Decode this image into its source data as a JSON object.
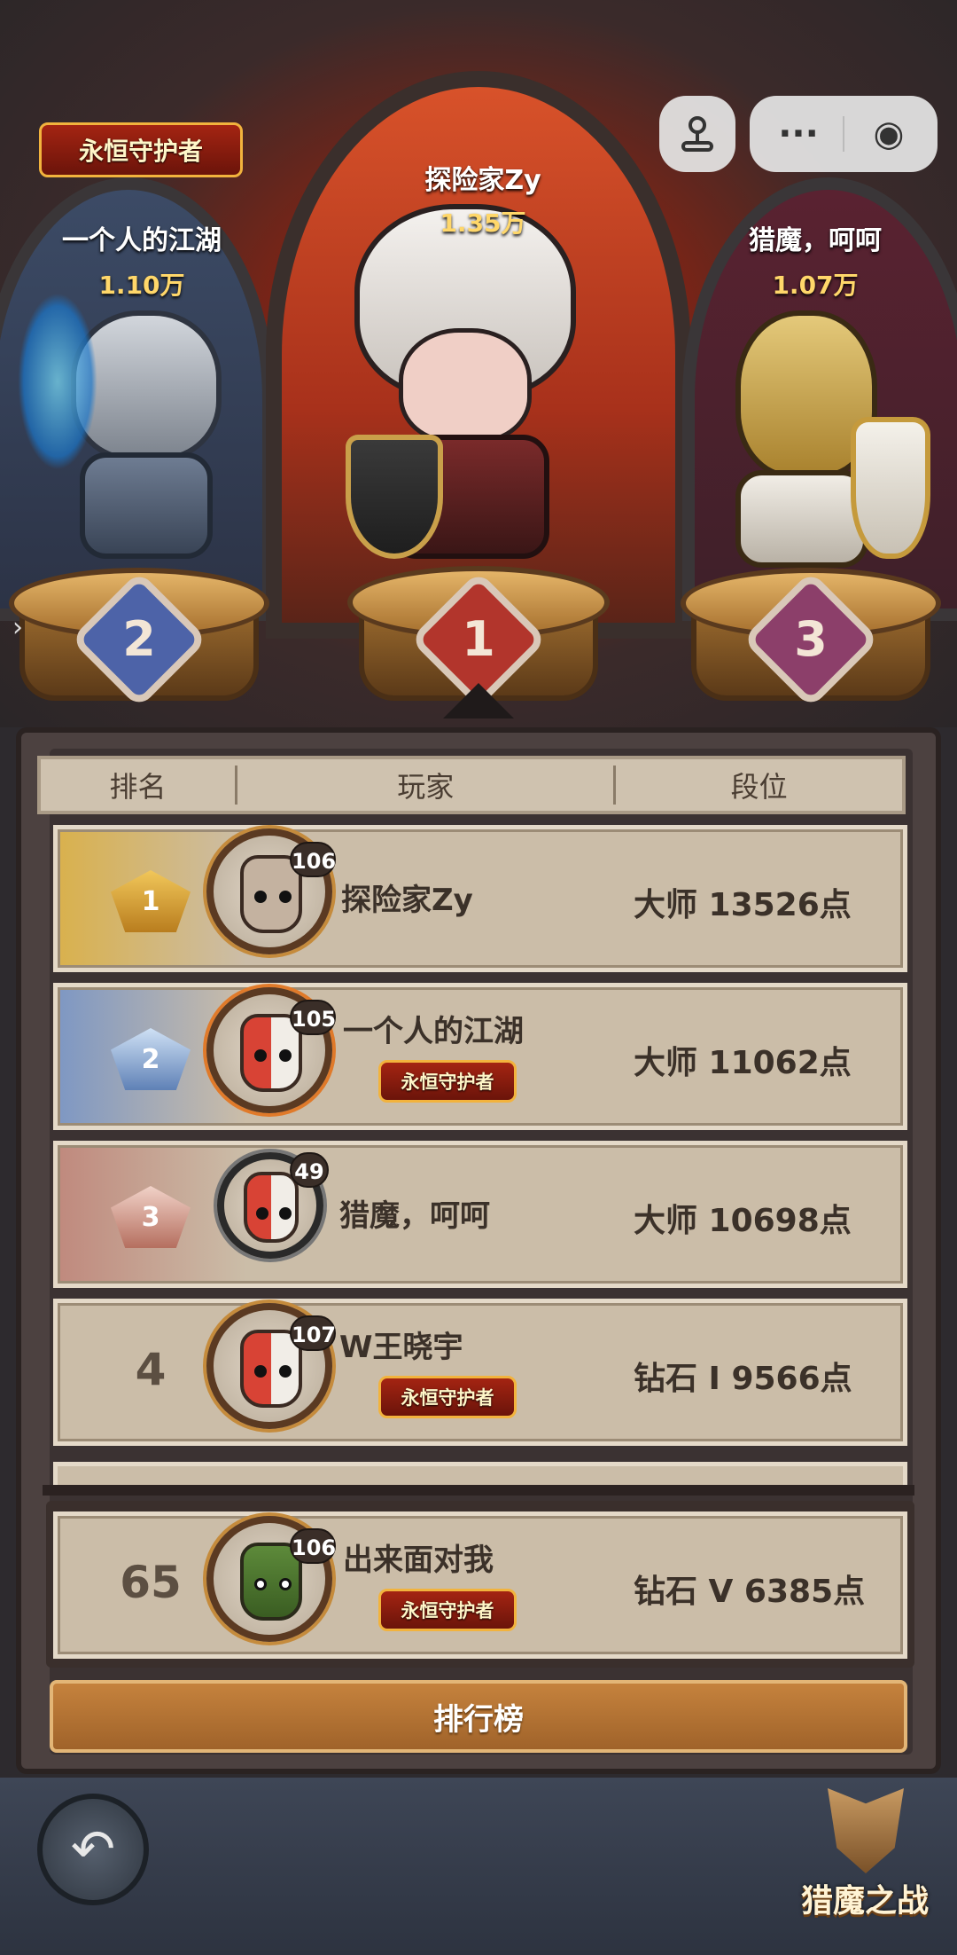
{
  "top3": [
    {
      "rank_badge": "1",
      "name": "探险家Zy",
      "score": "1.35万"
    },
    {
      "rank_badge": "2",
      "name": "一个人的江湖",
      "score": "1.10万",
      "title_badge": "永恒守护者"
    },
    {
      "rank_badge": "3",
      "name": "猎魔，呵呵",
      "score": "1.07万"
    }
  ],
  "header": {
    "rank": "排名",
    "player": "玩家",
    "tier": "段位"
  },
  "rows": [
    {
      "rank": "1",
      "level": "106",
      "name": "探险家Zy",
      "tier": "大师 13526点"
    },
    {
      "rank": "2",
      "level": "105",
      "name": "一个人的江湖",
      "title_badge": "永恒守护者",
      "tier": "大师 11062点"
    },
    {
      "rank": "3",
      "level": "49",
      "name": "猎魔，呵呵",
      "tier": "大师 10698点"
    },
    {
      "rank": "4",
      "level": "107",
      "name": "W王晓宇",
      "title_badge": "永恒守护者",
      "tier": "钻石 I  9566点"
    }
  ],
  "self": {
    "rank": "65",
    "level": "106",
    "name": "出来面对我",
    "title_badge": "永恒守护者",
    "tier": "钻石 V  6385点"
  },
  "leaderboard_button": "排行榜",
  "menu": {
    "more": "···",
    "close": "◉"
  },
  "game_logo": "猎魔之战",
  "icons": {
    "joystick": "joystick-icon",
    "back": "back-arrow-icon",
    "more": "more-icon",
    "close": "close-icon",
    "expand": "chevron-right-icon"
  },
  "colors": {
    "gold": "#e9c56a",
    "silver_blue": "#8ea5c6",
    "bronze": "#c98a7a",
    "button": "#b8732f"
  }
}
